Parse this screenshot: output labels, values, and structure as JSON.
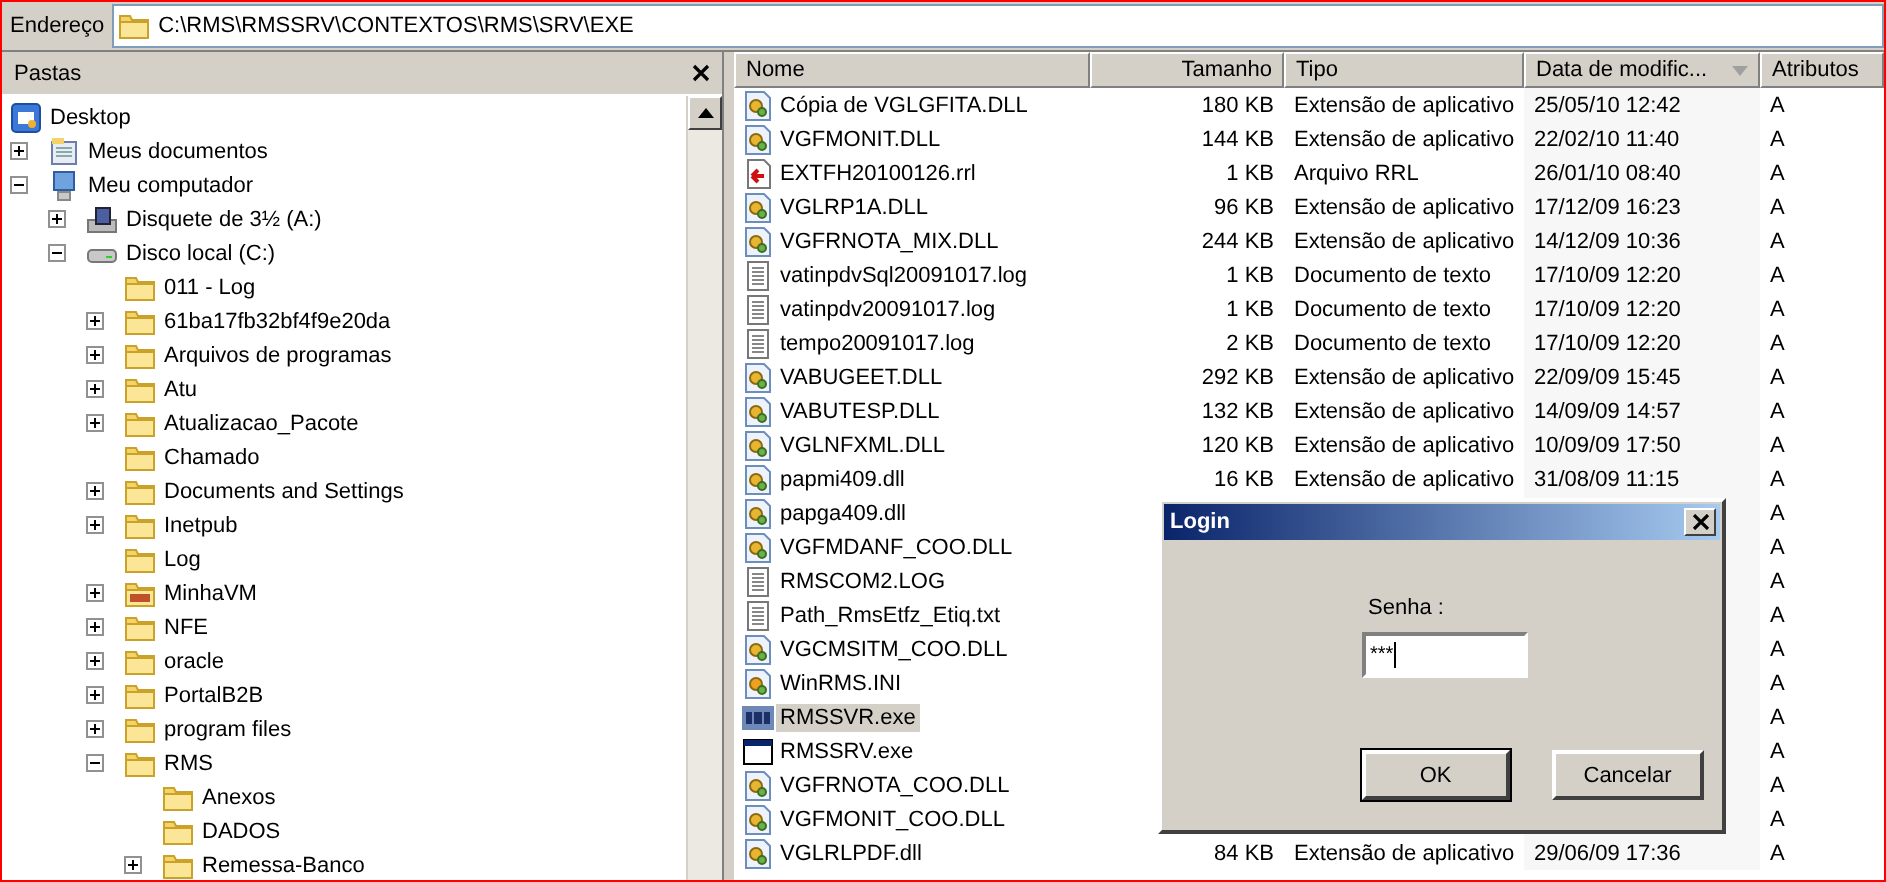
{
  "address_bar": {
    "label": "Endereço",
    "path": "C:\\RMS\\RMSSRV\\CONTEXTOS\\RMS\\SRV\\EXE"
  },
  "folders_pane": {
    "title": "Pastas",
    "tree": [
      {
        "label": "Desktop",
        "kind": "desktop",
        "children": [
          {
            "label": "Meus documentos",
            "kind": "documents",
            "expanded": false
          },
          {
            "label": "Meu computador",
            "kind": "computer",
            "expanded": true,
            "children": [
              {
                "label": "Disquete de 3½ (A:)",
                "kind": "floppy",
                "expanded": false
              },
              {
                "label": "Disco local (C:)",
                "kind": "drive",
                "expanded": true,
                "children": [
                  {
                    "label": "011 - Log",
                    "kind": "folder"
                  },
                  {
                    "label": "61ba17fb32bf4f9e20da",
                    "kind": "folder",
                    "expanded": false
                  },
                  {
                    "label": "Arquivos de programas",
                    "kind": "folder",
                    "expanded": false
                  },
                  {
                    "label": "Atu",
                    "kind": "folder",
                    "expanded": false
                  },
                  {
                    "label": "Atualizacao_Pacote",
                    "kind": "folder",
                    "expanded": false
                  },
                  {
                    "label": "Chamado",
                    "kind": "folder"
                  },
                  {
                    "label": "Documents and Settings",
                    "kind": "folder",
                    "expanded": false
                  },
                  {
                    "label": "Inetpub",
                    "kind": "folder",
                    "expanded": false
                  },
                  {
                    "label": "Log",
                    "kind": "folder"
                  },
                  {
                    "label": "MinhaVM",
                    "kind": "vm-folder",
                    "expanded": false
                  },
                  {
                    "label": "NFE",
                    "kind": "folder",
                    "expanded": false
                  },
                  {
                    "label": "oracle",
                    "kind": "folder",
                    "expanded": false
                  },
                  {
                    "label": "PortalB2B",
                    "kind": "folder",
                    "expanded": false
                  },
                  {
                    "label": "program files",
                    "kind": "folder",
                    "expanded": false
                  },
                  {
                    "label": "RMS",
                    "kind": "folder",
                    "expanded": true,
                    "children": [
                      {
                        "label": "Anexos",
                        "kind": "folder"
                      },
                      {
                        "label": "DADOS",
                        "kind": "folder"
                      },
                      {
                        "label": "Remessa-Banco",
                        "kind": "folder",
                        "expanded": false
                      }
                    ]
                  }
                ]
              }
            ]
          }
        ]
      }
    ]
  },
  "file_list": {
    "columns": [
      {
        "label": "Nome",
        "sorted": false
      },
      {
        "label": "Tamanho",
        "sorted": false
      },
      {
        "label": "Tipo",
        "sorted": false
      },
      {
        "label": "Data de modific...",
        "sorted": true
      },
      {
        "label": "Atributos",
        "sorted": false
      }
    ],
    "rows": [
      {
        "name": "Cópia de VGLGFITA.DLL",
        "kind": "dll",
        "size": "180 KB",
        "type": "Extensão de aplicativo",
        "modified": "25/05/10 12:42",
        "attributes": "A",
        "selected": false
      },
      {
        "name": "VGFMONIT.DLL",
        "kind": "dll",
        "size": "144 KB",
        "type": "Extensão de aplicativo",
        "modified": "22/02/10 11:40",
        "attributes": "A",
        "selected": false
      },
      {
        "name": "EXTFH20100126.rrl",
        "kind": "rrl",
        "size": "1 KB",
        "type": "Arquivo RRL",
        "modified": "26/01/10 08:40",
        "attributes": "A",
        "selected": false
      },
      {
        "name": "VGLRP1A.DLL",
        "kind": "dll",
        "size": "96 KB",
        "type": "Extensão de aplicativo",
        "modified": "17/12/09 16:23",
        "attributes": "A",
        "selected": false
      },
      {
        "name": "VGFRNOTA_MIX.DLL",
        "kind": "dll",
        "size": "244 KB",
        "type": "Extensão de aplicativo",
        "modified": "14/12/09 10:36",
        "attributes": "A",
        "selected": false
      },
      {
        "name": "vatinpdvSql20091017.log",
        "kind": "text",
        "size": "1 KB",
        "type": "Documento de texto",
        "modified": "17/10/09 12:20",
        "attributes": "A",
        "selected": false
      },
      {
        "name": "vatinpdv20091017.log",
        "kind": "text",
        "size": "1 KB",
        "type": "Documento de texto",
        "modified": "17/10/09 12:20",
        "attributes": "A",
        "selected": false
      },
      {
        "name": "tempo20091017.log",
        "kind": "text",
        "size": "2 KB",
        "type": "Documento de texto",
        "modified": "17/10/09 12:20",
        "attributes": "A",
        "selected": false
      },
      {
        "name": "VABUGEET.DLL",
        "kind": "dll",
        "size": "292 KB",
        "type": "Extensão de aplicativo",
        "modified": "22/09/09 15:45",
        "attributes": "A",
        "selected": false
      },
      {
        "name": "VABUTESP.DLL",
        "kind": "dll",
        "size": "132 KB",
        "type": "Extensão de aplicativo",
        "modified": "14/09/09 14:57",
        "attributes": "A",
        "selected": false
      },
      {
        "name": "VGLNFXML.DLL",
        "kind": "dll",
        "size": "120 KB",
        "type": "Extensão de aplicativo",
        "modified": "10/09/09 17:50",
        "attributes": "A",
        "selected": false
      },
      {
        "name": "papmi409.dll",
        "kind": "dll",
        "size": "16 KB",
        "type": "Extensão de aplicativo",
        "modified": "31/08/09 11:15",
        "attributes": "A",
        "selected": false
      },
      {
        "name": "papga409.dll",
        "kind": "dll",
        "attributes": "A",
        "selected": false
      },
      {
        "name": "VGFMDANF_COO.DLL",
        "kind": "dll",
        "attributes": "A",
        "selected": false
      },
      {
        "name": "RMSCOM2.LOG",
        "kind": "text",
        "attributes": "A",
        "selected": false
      },
      {
        "name": "Path_RmsEtfz_Etiq.txt",
        "kind": "text",
        "attributes": "A",
        "selected": false
      },
      {
        "name": "VGCMSITM_COO.DLL",
        "kind": "dll",
        "attributes": "A",
        "selected": false
      },
      {
        "name": "WinRMS.INI",
        "kind": "ini",
        "attributes": "A",
        "selected": false
      },
      {
        "name": "RMSSVR.exe",
        "kind": "rms-exe",
        "attributes": "A",
        "selected": true
      },
      {
        "name": "RMSSRV.exe",
        "kind": "exe",
        "attributes": "A",
        "selected": false
      },
      {
        "name": "VGFRNOTA_COO.DLL",
        "kind": "dll",
        "attributes": "A",
        "selected": false
      },
      {
        "name": "VGFMONIT_COO.DLL",
        "kind": "dll",
        "attributes": "A",
        "selected": false
      },
      {
        "name": "VGLRLPDF.dll",
        "kind": "dll",
        "size": "84 KB",
        "type": "Extensão de aplicativo",
        "modified": "29/06/09 17:36",
        "attributes": "A",
        "selected": false
      }
    ]
  },
  "dialog": {
    "title": "Login",
    "field_label": "Senha :",
    "password": "***",
    "buttons": [
      {
        "label": "OK",
        "default": true
      },
      {
        "label": "Cancelar",
        "default": false
      }
    ]
  }
}
